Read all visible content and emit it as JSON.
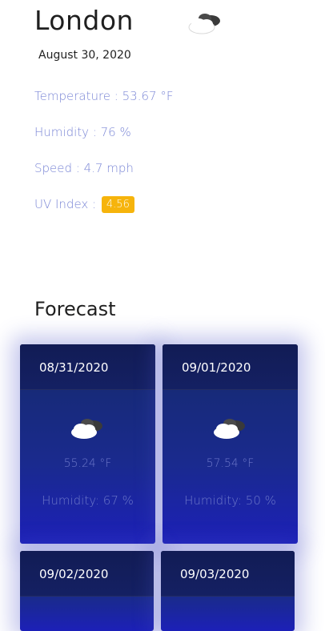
{
  "current": {
    "city": "London",
    "date": "August 30, 2020",
    "icon": "cloudy-icon",
    "temperature_label": "Temperature : 53.67 °F",
    "humidity_label": "Humidity : 76 %",
    "speed_label": "Speed : 4.7 mph",
    "uv_label": "UV Index :",
    "uv_value": "4.56",
    "uv_color": "#f6b40c",
    "stat_color": "#7b87d6"
  },
  "forecast": {
    "title": "Forecast",
    "cards": [
      {
        "date": "08/31/2020",
        "icon": "cloudy-icon",
        "temp": "55.24 °F",
        "humidity": "Humidity: 67 %"
      },
      {
        "date": "09/01/2020",
        "icon": "cloudy-icon",
        "temp": "57.54 °F",
        "humidity": "Humidity: 50 %"
      },
      {
        "date": "09/02/2020"
      },
      {
        "date": "09/03/2020"
      }
    ]
  }
}
